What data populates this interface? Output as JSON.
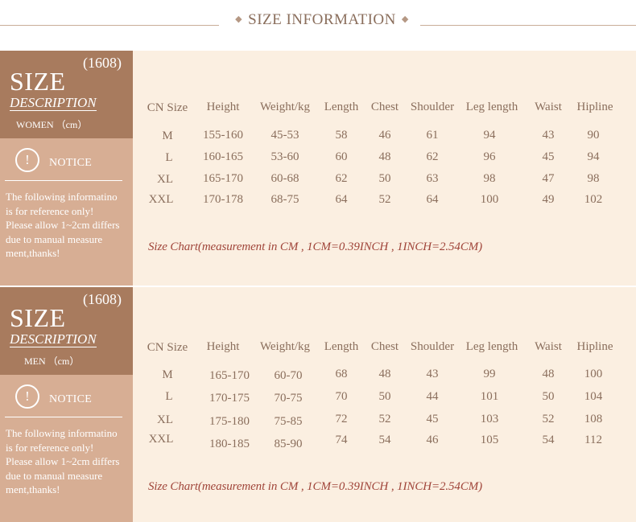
{
  "header": {
    "title": "SIZE INFORMATION"
  },
  "columns": [
    "CN Size",
    "Height",
    "Weight/kg",
    "Length",
    "Chest",
    "Shoulder",
    "Leg length",
    "Waist",
    "Hipline"
  ],
  "panels": [
    {
      "code": "(1608)",
      "size_word": "SIZE",
      "description": "DESCRIPTION",
      "group_label": "WOMEN （cm）",
      "notice_label": "NOTICE",
      "notice_icon": "exclamation-circle-icon",
      "note_lines": [
        "The following informatino",
        "is for reference only!",
        "Please allow 1~2cm differs",
        "due to manual measure",
        "ment,thanks!"
      ],
      "rows": [
        [
          "M",
          "155-160",
          "45-53",
          "58",
          "46",
          "61",
          "94",
          "43",
          "90"
        ],
        [
          "L",
          "160-165",
          "53-60",
          "60",
          "48",
          "62",
          "96",
          "45",
          "94"
        ],
        [
          "XL",
          "165-170",
          "60-68",
          "62",
          "50",
          "63",
          "98",
          "47",
          "98"
        ],
        [
          "XXL",
          "170-178",
          "68-75",
          "64",
          "52",
          "64",
          "100",
          "49",
          "102"
        ]
      ],
      "size_chart_note": "Size Chart(measurement in CM , 1CM=0.39INCH , 1INCH=2.54CM)"
    },
    {
      "code": "(1608)",
      "size_word": "SIZE",
      "description": "DESCRIPTION",
      "group_label": "MEN （cm）",
      "notice_label": "NOTICE",
      "notice_icon": "exclamation-circle-icon",
      "note_lines": [
        "The following informatino",
        "is for reference only!",
        "Please allow 1~2cm differs",
        "due to manual measure",
        "ment,thanks!"
      ],
      "rows": [
        [
          "M",
          "165-170",
          "60-70",
          "68",
          "48",
          "43",
          "99",
          "48",
          "100"
        ],
        [
          "L",
          "170-175",
          "70-75",
          "70",
          "50",
          "44",
          "101",
          "50",
          "104"
        ],
        [
          "XL",
          "175-180",
          "75-85",
          "72",
          "52",
          "45",
          "103",
          "52",
          "108"
        ],
        [
          "XXL",
          "180-185",
          "85-90",
          "74",
          "54",
          "46",
          "105",
          "54",
          "112"
        ]
      ],
      "size_chart_note": "Size Chart(measurement in CM , 1CM=0.39INCH , 1INCH=2.54CM)"
    }
  ]
}
